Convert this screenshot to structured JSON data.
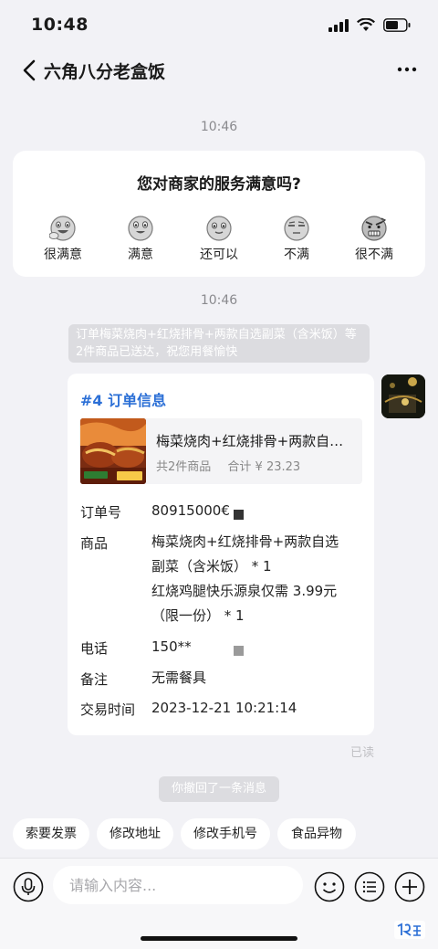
{
  "status_bar": {
    "time": "10:48"
  },
  "nav": {
    "title": "六角八分老盒饭"
  },
  "messages": {
    "timestamp_1": "10:46",
    "timestamp_2": "10:46",
    "survey": {
      "question": "您对商家的服务满意吗?",
      "options": [
        {
          "label": "很满意",
          "icon": "very-satisfied-face-icon"
        },
        {
          "label": "满意",
          "icon": "satisfied-face-icon"
        },
        {
          "label": "还可以",
          "icon": "neutral-face-icon"
        },
        {
          "label": "不满",
          "icon": "unsatisfied-face-icon"
        },
        {
          "label": "很不满",
          "icon": "angry-face-icon"
        }
      ]
    },
    "delivery_notice": "订单梅菜烧肉+红烧排骨+两款自选副菜（含米饭）等2件商品已送达，祝您用餐愉快",
    "order_card": {
      "title": "#4 订单信息",
      "product_name": "梅菜烧肉+红烧排骨+两款自选副菜（含米饭）",
      "item_count": "共2件商品",
      "total": "合计 ¥ 23.23",
      "fields": {
        "order_no_label": "订单号",
        "order_no_value": "80915000€",
        "goods_label": "商品",
        "goods_line1": "梅菜烧肉+红烧排骨+两款自选",
        "goods_line2": "副菜（含米饭） * 1",
        "goods_line3": "红烧鸡腿快乐源泉仅需 3.99元",
        "goods_line4": "（限一份） * 1",
        "phone_label": "电话",
        "phone_value": "150**",
        "note_label": "备注",
        "note_value": "无需餐具",
        "time_label": "交易时间",
        "time_value": "2023-12-21 10:21:14"
      }
    },
    "read_status": "已读",
    "recall_notice": "你撤回了一条消息"
  },
  "quick_replies": [
    "索要发票",
    "修改地址",
    "修改手机号",
    "食品异物"
  ],
  "input_bar": {
    "placeholder": "请输入内容..."
  },
  "colors": {
    "accent": "#2b6fd6",
    "background": "#f2f2f6"
  }
}
